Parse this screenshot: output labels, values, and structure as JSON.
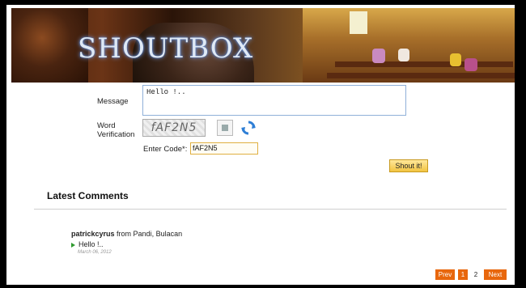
{
  "banner": {
    "title": "SHOUTBOX"
  },
  "form": {
    "message_label": "Message",
    "message_value": "Hello !..",
    "word_label_line1": "Word",
    "word_label_line2": "Verification",
    "captcha_text": "fAF2N5",
    "code_label": "Enter Code*:",
    "code_value": "fAF2N5",
    "submit_label": "Shout it!"
  },
  "comments": {
    "heading": "Latest Comments",
    "items": [
      {
        "author": "patrickcyrus",
        "location": "from Pandi, Bulacan",
        "text": "Hello !..",
        "date": "March 06, 2012"
      }
    ]
  },
  "pagination": {
    "prev": "Prev",
    "pages": [
      "1",
      "2"
    ],
    "current_page": "2",
    "next": "Next"
  },
  "colors": {
    "accent": "#e8670d",
    "button": "#f2c442",
    "link_arrow": "#2f9a2f"
  },
  "icons": [
    "audio-captcha-icon",
    "refresh-captcha-icon",
    "green-arrow-icon"
  ]
}
